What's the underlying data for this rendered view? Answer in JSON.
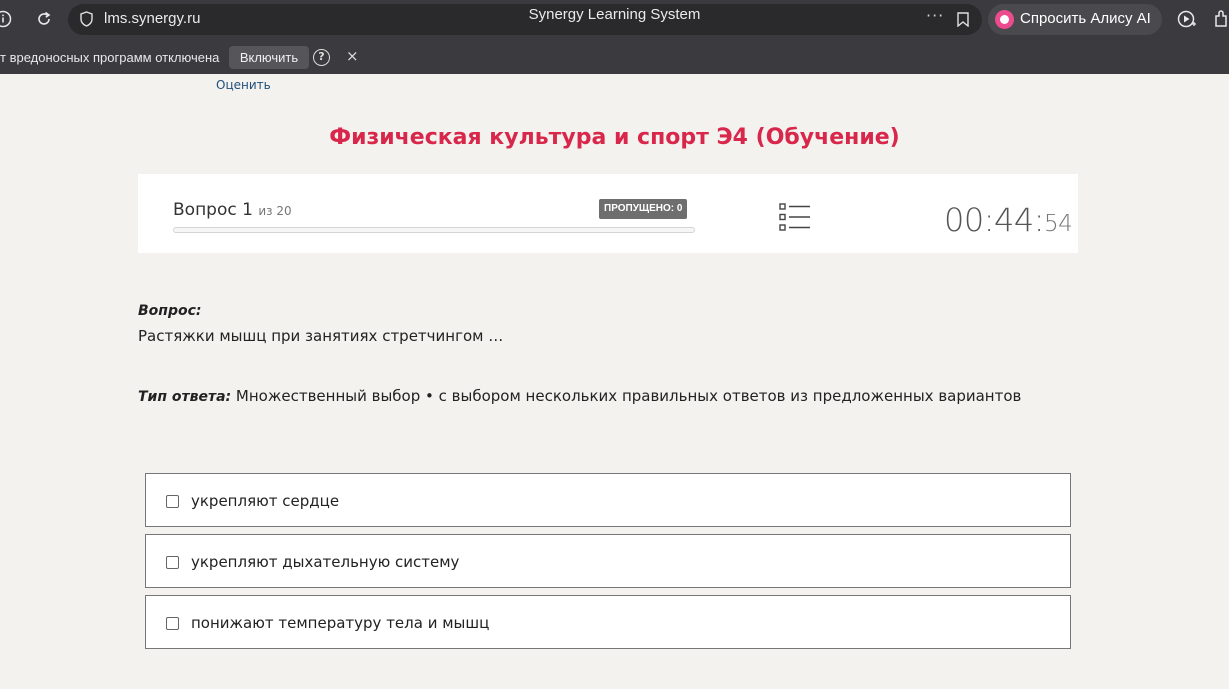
{
  "browser": {
    "url": "lms.synergy.ru",
    "tab_title": "Synergy Learning System",
    "more_label": "···",
    "alice_label": "Спросить Алису AI",
    "warning_text": "т вредоносных программ отключена",
    "enable_label": "Включить",
    "help_label": "?",
    "close_label": "×"
  },
  "page": {
    "rate_link": "Оценить",
    "course_title": "Физическая культура и спорт Э4 (Обучение)"
  },
  "progress": {
    "question_label": "Вопрос 1",
    "question_of": "из 20",
    "skipped": "ПРОПУЩЕНО: 0",
    "progress_fraction": 0.0,
    "timer_main": "00:44:",
    "timer_seconds": "54"
  },
  "question": {
    "label": "Вопрос:",
    "text": "Растяжки мышц при занятиях стретчингом …",
    "answer_type_label": "Тип ответа:",
    "answer_type_value": " Множественный выбор • с выбором нескольких правильных ответов из предложенных вариантов"
  },
  "options": [
    {
      "label": "укрепляют сердце",
      "checked": false
    },
    {
      "label": "укрепляют дыхательную систему",
      "checked": false
    },
    {
      "label": "понижают температуру тела и мышц",
      "checked": false
    }
  ],
  "colors": {
    "accent": "#d8274a",
    "chrome": "#3b3b3f",
    "page_bg": "#f3f2ef"
  }
}
